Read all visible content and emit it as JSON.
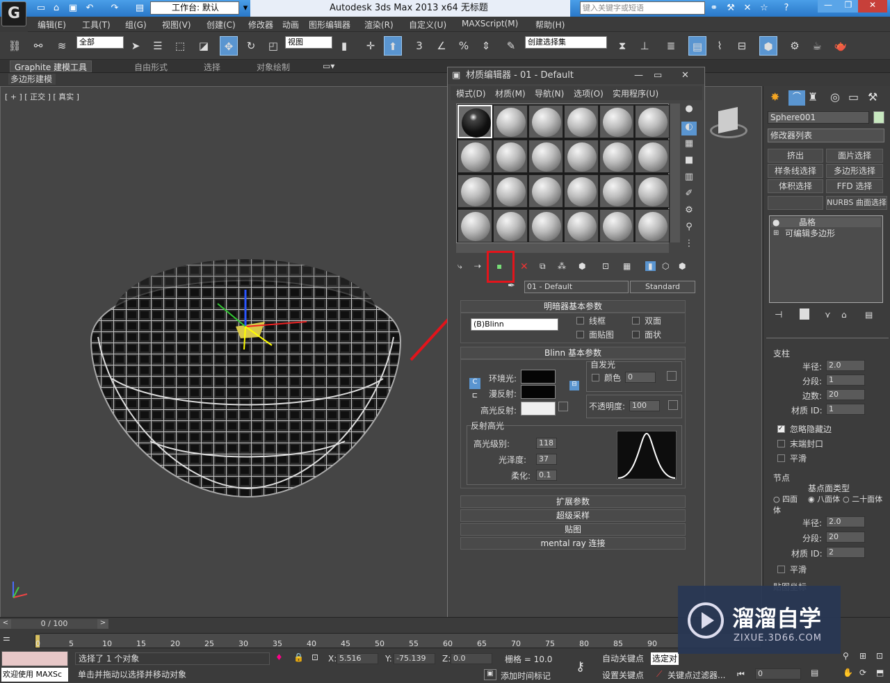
{
  "app": {
    "workspace": "工作台: 默认",
    "title": "Autodesk 3ds Max  2013 x64      无标题",
    "search_placeholder": "键入关键字或短语"
  },
  "menu": [
    "编辑(E)",
    "工具(T)",
    "组(G)",
    "视图(V)",
    "创建(C)",
    "修改器",
    "动画",
    "图形编辑器",
    "渲染(R)",
    "自定义(U)",
    "MAXScript(M)",
    "帮助(H)"
  ],
  "toolbar": {
    "filter": "全部",
    "refcoord": "视图",
    "selset": "创建选择集",
    "snap_label": "3",
    "percent": "%"
  },
  "ribbon": {
    "tabs": [
      "Graphite 建模工具",
      "自由形式",
      "选择",
      "对象绘制"
    ],
    "sub": "多边形建模"
  },
  "viewport": {
    "label": "[ + ] [ 正交 ] [ 真实 ]"
  },
  "material_editor": {
    "title": "材质编辑器 - 01 - Default",
    "menu": [
      "模式(D)",
      "材质(M)",
      "导航(N)",
      "选项(O)",
      "实用程序(U)"
    ],
    "material_name": "01 - Default",
    "material_type": "Standard",
    "shader_rollout": "明暗器基本参数",
    "shader": "(B)Blinn",
    "shader_opts": [
      "线框",
      "双面",
      "面贴图",
      "面状"
    ],
    "blinn_rollout": "Blinn 基本参数",
    "self_illum": "自发光",
    "color_label": "颜色",
    "self_illum_val": "0",
    "ambient": "环境光:",
    "diffuse": "漫反射:",
    "specular": "高光反射:",
    "opacity_label": "不透明度:",
    "opacity": "100",
    "spec_hl": "反射高光",
    "spec_level_label": "高光级别:",
    "spec_level": "118",
    "gloss_label": "光泽度:",
    "gloss": "37",
    "soften_label": "柔化:",
    "soften": "0.1",
    "rollouts": [
      "扩展参数",
      "超级采样",
      "贴图",
      "mental ray 连接"
    ],
    "colors": {
      "ambient": "#050505",
      "diffuse": "#050505",
      "specular": "#f0f0f0"
    }
  },
  "cmd": {
    "object": "Sphere001",
    "modlist": "修改器列表",
    "buttons": [
      "挤出",
      "面片选择",
      "样条线选择",
      "多边形选择",
      "体积选择",
      "FFD 选择",
      "",
      "NURBS 曲面选择"
    ],
    "stack": [
      "晶格",
      "可编辑多边形"
    ],
    "struts": "支柱",
    "radius_label": "半径:",
    "radius": "2.0",
    "segs_label": "分段:",
    "segs": "1",
    "sides_label": "边数:",
    "sides": "20",
    "matid_label": "材质 ID:",
    "matid": "1",
    "ignore_hidden": "忽略隐藏边",
    "end_caps": "末端封口",
    "smooth": "平滑",
    "joints": "节点",
    "geo_type": "基点面类型",
    "tetra": "四面体",
    "octa": "八面体",
    "icosa": "二十面体",
    "j_radius": "2.0",
    "j_segs": "20",
    "j_matid": "2",
    "j_smooth": "平滑",
    "mapping": "贴图坐标"
  },
  "status": {
    "timeline": "0 / 100",
    "ticks": [
      "0",
      "5",
      "10",
      "15",
      "20",
      "25",
      "30",
      "35",
      "40",
      "45",
      "50",
      "55",
      "60",
      "65",
      "70",
      "75",
      "80",
      "85",
      "90"
    ],
    "selected": "选择了 1 个对象",
    "prompt": "单击并拖动以选择并移动对象",
    "welcome": "欢迎使用 MAXSc",
    "x_label": "X:",
    "x": "5.516",
    "y_label": "Y:",
    "y": "-75.139",
    "z_label": "Z:",
    "z": "0.0",
    "grid": "栅格 = 10.0",
    "autokey": "自动关键点",
    "selobj": "选定对",
    "setkey": "设置关键点",
    "keyfilter": "关键点过滤器...",
    "addtime": "添加时间标记",
    "frame": "0"
  },
  "watermark": {
    "brand": "溜溜自学",
    "url": "ZIXUE.3D66.COM"
  }
}
